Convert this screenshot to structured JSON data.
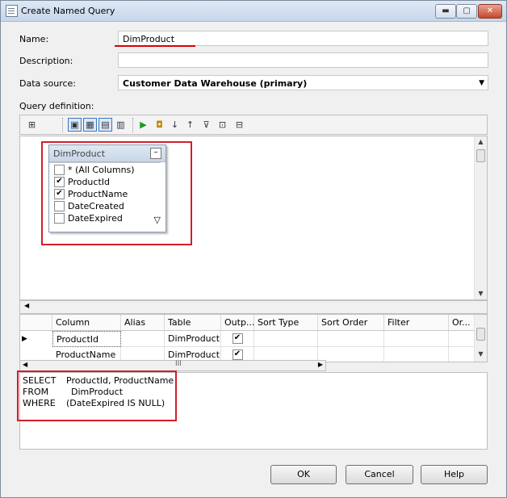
{
  "window": {
    "title": "Create Named Query",
    "min_label": "▬",
    "max_label": "▢",
    "close_label": "✕"
  },
  "form": {
    "name_label": "Name:",
    "name_value": "DimProduct",
    "description_label": "Description:",
    "description_value": "",
    "datasource_label": "Data source:",
    "datasource_value": "Customer Data Warehouse (primary)",
    "query_label": "Query definition:"
  },
  "toolbar": {
    "icons": [
      "add-table-icon",
      "diagram-pane-icon",
      "grid-pane-icon",
      "sql-pane-icon",
      "results-pane-icon",
      "run-icon",
      "verify-sql-icon",
      "sort-ascending-icon",
      "sort-descending-icon",
      "remove-filter-icon",
      "use-group-by-icon",
      "add-derived-table-icon"
    ]
  },
  "table_card": {
    "title": "DimProduct",
    "collapse": "–",
    "columns": [
      {
        "label": "* (All Columns)",
        "checked": false
      },
      {
        "label": "ProductId",
        "checked": true
      },
      {
        "label": "ProductName",
        "checked": true
      },
      {
        "label": "DateCreated",
        "checked": false
      },
      {
        "label": "DateExpired",
        "checked": false
      }
    ]
  },
  "grid": {
    "headers": [
      "Column",
      "Alias",
      "Table",
      "Outp...",
      "Sort Type",
      "Sort Order",
      "Filter",
      "Or..."
    ],
    "rows": [
      {
        "column": "ProductId",
        "alias": "",
        "table": "DimProduct",
        "output": true
      },
      {
        "column": "ProductName",
        "alias": "",
        "table": "DimProduct",
        "output": true
      }
    ],
    "hscroll_label": "III"
  },
  "sql": {
    "lines": [
      {
        "kw": "SELECT",
        "val": "ProductId, ProductName"
      },
      {
        "kw": "FROM",
        "val": "DimProduct"
      },
      {
        "kw": "WHERE",
        "val": "(DateExpired IS NULL)"
      }
    ]
  },
  "buttons": {
    "ok": "OK",
    "cancel": "Cancel",
    "help": "Help"
  },
  "colors": {
    "highlight": "#d0202a",
    "selection": "#3a77c2"
  }
}
